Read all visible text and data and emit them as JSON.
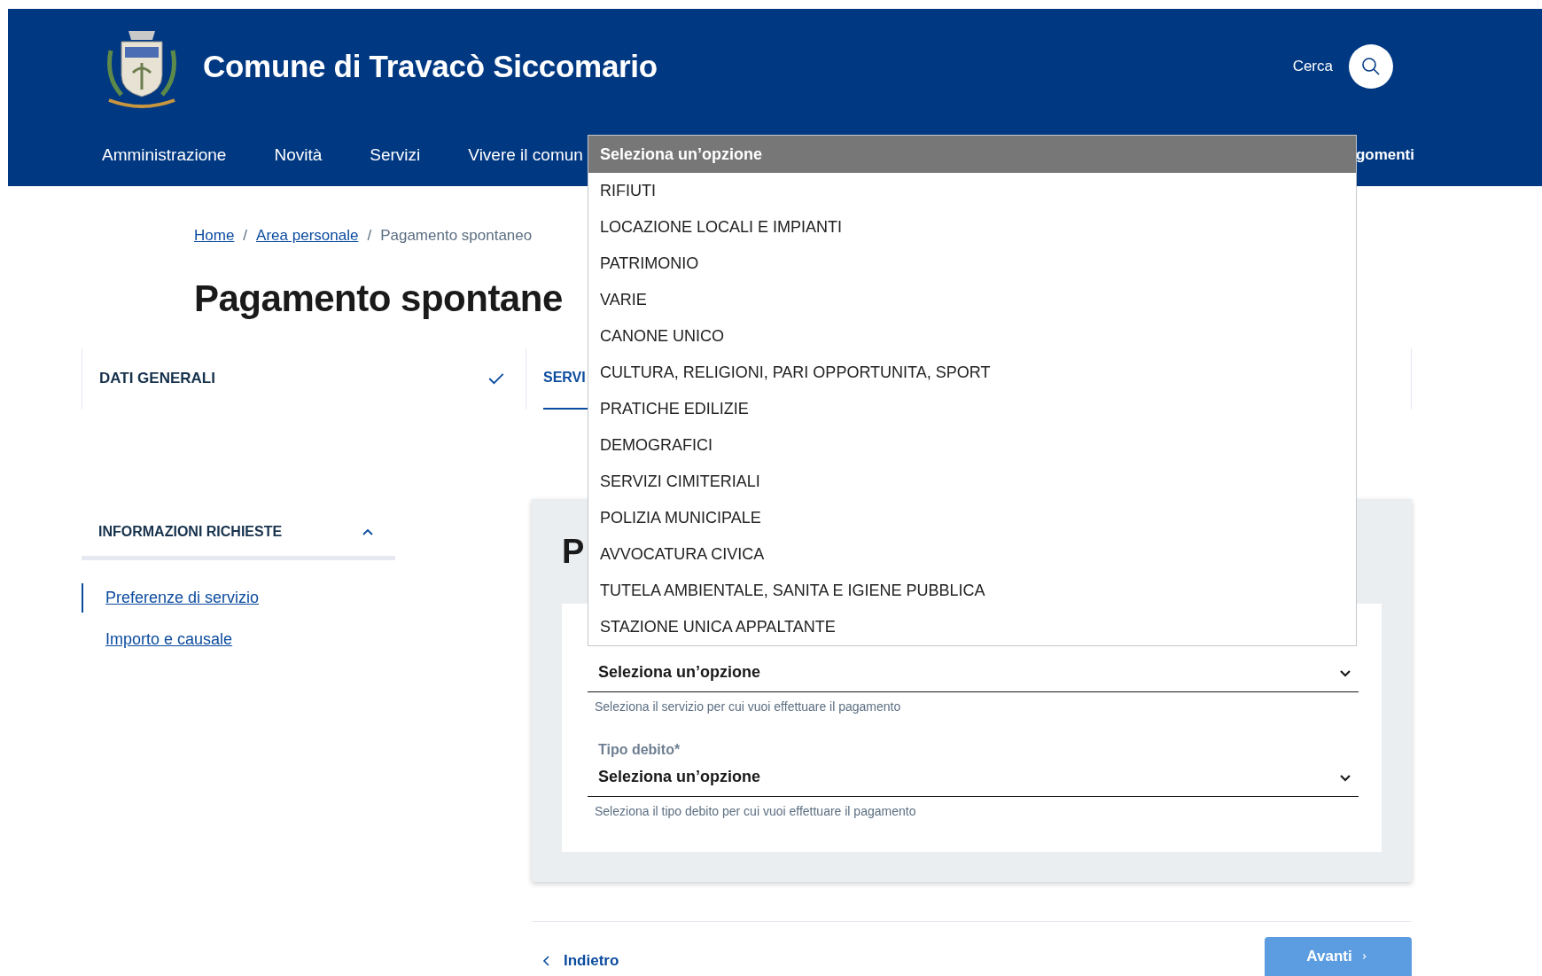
{
  "header": {
    "title": "Comune di Travacò Siccomario",
    "search_label": "Cerca"
  },
  "nav": {
    "items": [
      "Amministrazione",
      "Novità",
      "Servizi",
      "Vivere il comun"
    ],
    "end_item": "gomenti"
  },
  "breadcrumb": [
    {
      "label": "Home",
      "link": true
    },
    {
      "separator": "/",
      "label": "Area personale",
      "link": true
    },
    {
      "separator": "/",
      "label": "Pagamento spontaneo",
      "link": false
    }
  ],
  "page_title": "Pagamento spontane",
  "steps": [
    {
      "label": "DATI GENERALI",
      "completed": true,
      "selected": false
    },
    {
      "label": "SERVI",
      "completed": false,
      "selected": true
    }
  ],
  "sidebar": {
    "title": "INFORMAZIONI RICHIESTE",
    "expanded": true,
    "links": [
      {
        "label": "Preferenze di servizio",
        "selected": true
      },
      {
        "label": "Importo e causale",
        "selected": false
      }
    ]
  },
  "card": {
    "heading": "P",
    "fields": [
      {
        "value": "Seleziona un’opzione",
        "hint": "Seleziona il servizio per cui vuoi effettuare il pagamento"
      },
      {
        "label": "Tipo debito*",
        "value": "Seleziona un’opzione",
        "hint": "Seleziona il tipo debito per cui vuoi effettuare il pagamento"
      }
    ]
  },
  "dropdown": {
    "options": [
      {
        "label": "Seleziona un’opzione",
        "selected": true
      },
      {
        "label": "RIFIUTI",
        "selected": false
      },
      {
        "label": "LOCAZIONE LOCALI E IMPIANTI",
        "selected": false
      },
      {
        "label": "PATRIMONIO",
        "selected": false
      },
      {
        "label": "VARIE",
        "selected": false
      },
      {
        "label": "CANONE UNICO",
        "selected": false
      },
      {
        "label": "CULTURA, RELIGIONI, PARI OPPORTUNITA, SPORT",
        "selected": false
      },
      {
        "label": "PRATICHE EDILIZIE",
        "selected": false
      },
      {
        "label": "DEMOGRAFICI",
        "selected": false
      },
      {
        "label": "SERVIZI CIMITERIALI",
        "selected": false
      },
      {
        "label": "POLIZIA MUNICIPALE",
        "selected": false
      },
      {
        "label": "AVVOCATURA CIVICA",
        "selected": false
      },
      {
        "label": "TUTELA AMBIENTALE, SANITA E IGIENE PUBBLICA",
        "selected": false
      },
      {
        "label": "STAZIONE UNICA APPALTANTE",
        "selected": false
      }
    ]
  },
  "footer": {
    "back": "Indietro",
    "next": "Avanti"
  }
}
